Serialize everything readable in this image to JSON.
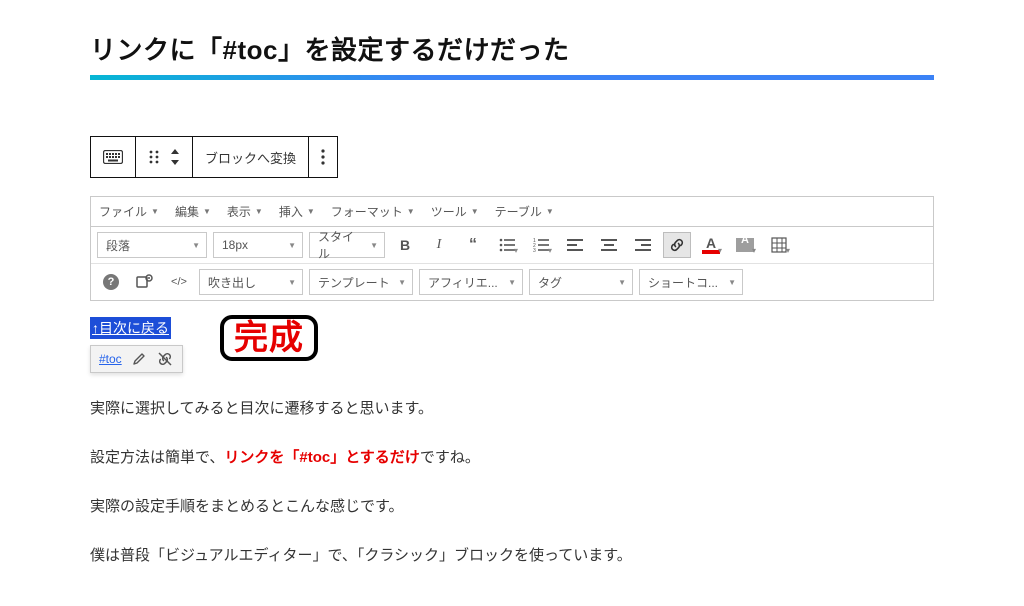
{
  "heading": "リンクに「#toc」を設定するだけだった",
  "block_toolbar": {
    "convert_label": "ブロックへ変換"
  },
  "menubar": {
    "items": [
      {
        "label": "ファイル"
      },
      {
        "label": "編集"
      },
      {
        "label": "表示"
      },
      {
        "label": "挿入"
      },
      {
        "label": "フォーマット"
      },
      {
        "label": "ツール"
      },
      {
        "label": "テーブル"
      }
    ]
  },
  "toolbar_row1": {
    "paragraph": "段落",
    "fontsize": "18px",
    "style": "スタイル"
  },
  "toolbar_row2": {
    "select1": "吹き出し",
    "select2": "テンプレート",
    "select3": "アフィリエ...",
    "select4": "タグ",
    "select5": "ショートコ..."
  },
  "editor_content": {
    "selected_link_text": "↑目次に戻る",
    "tooltip_link": "#toc",
    "done_stamp": "完成"
  },
  "body": {
    "p1": "実際に選択してみると目次に遷移すると思います。",
    "p2_a": "設定方法は簡単で、",
    "p2_b": "リンクを「#toc」とするだけ",
    "p2_c": "ですね。",
    "p3": "実際の設定手順をまとめるとこんな感じです。",
    "p4": "僕は普段「ビジュアルエディター」で、「クラシック」ブロックを使っています。"
  }
}
